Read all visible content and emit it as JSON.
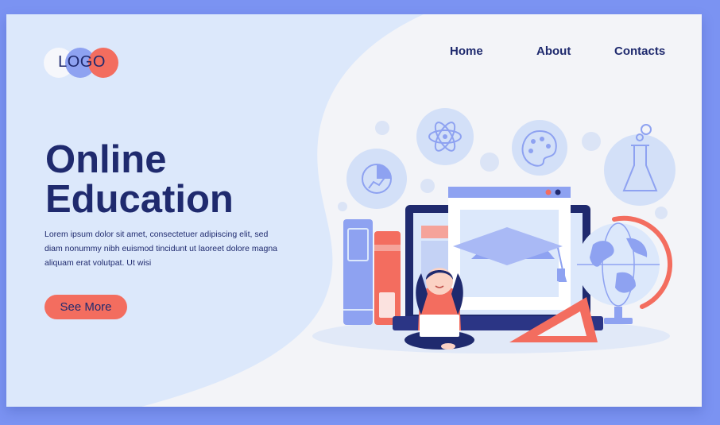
{
  "logo": {
    "text": "LOGO"
  },
  "nav": {
    "home": "Home",
    "about": "About",
    "contacts": "Contacts"
  },
  "hero": {
    "title_line1": "Online",
    "title_line2": "Education",
    "description": "Lorem ipsum dolor sit amet, consectetuer adipiscing elit, sed diam nonummy nibh euismod tincidunt ut laoreet dolore magna aliquam erat volutpat. Ut wisi",
    "cta_label": "See More"
  },
  "icons": [
    "pie-chart-icon",
    "atom-icon",
    "palette-icon",
    "flask-icon",
    "graduation-cap-icon",
    "globe-icon",
    "ruler-triangle-icon",
    "books-icon",
    "student-with-laptop-icon"
  ],
  "colors": {
    "frame": "#7b93f2",
    "card": "#f3f4f8",
    "hero_blob": "#dce8fb",
    "navy": "#1f2a6e",
    "accent_red": "#f36d5f",
    "accent_blue": "#8ea2f1"
  }
}
